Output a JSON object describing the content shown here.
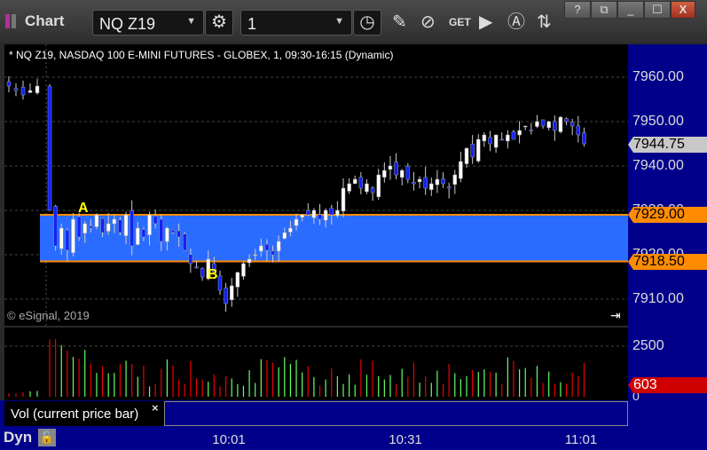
{
  "window": {
    "title": "Chart",
    "help": "?",
    "minimize": "_",
    "maximize": "☐",
    "close": "X"
  },
  "toolbar": {
    "symbol": "NQ Z19",
    "interval": "1"
  },
  "chart": {
    "header": "* NQ Z19, NASDAQ 100 E-MINI FUTURES - GLOBEX, 1, 09:30-16:15 (Dynamic)",
    "copyright": "© eSignal, 2019",
    "price_ticks": [
      "7960.00",
      "7950.00",
      "7940.00",
      "7930.00",
      "7920.00",
      "7910.00"
    ],
    "last_price": "7944.75",
    "level_high": "7929.00",
    "level_low": "7918.50",
    "label_a": "A",
    "label_b": "B",
    "zone_color": "#2a6cff",
    "level_color": "#ff8c00",
    "vol_ticks": [
      "2500",
      "0"
    ],
    "vol_last": "603",
    "vol_legend": "Vol (current price bar)",
    "vol_close": "×",
    "time_ticks": [
      "10:01",
      "10:31",
      "11:01"
    ],
    "mode": "Dyn",
    "price_series": [
      7958,
      7957,
      7956,
      7957,
      7958,
      7930,
      7922,
      7926,
      7921,
      7928,
      7924,
      7927,
      7926,
      7929,
      7925,
      7927,
      7928,
      7925,
      7929,
      7922,
      7926,
      7924,
      7929,
      7927,
      7923,
      7926,
      7925,
      7924,
      7921,
      7918,
      7917,
      7915,
      7919,
      7916,
      7912,
      7909,
      7913,
      7916,
      7918,
      7919,
      7920,
      7922,
      7921,
      7920,
      7923,
      7925,
      7926,
      7928,
      7929,
      7929,
      7930,
      7928,
      7930,
      7929,
      7930,
      7935,
      7936,
      7937,
      7935,
      7936,
      7934,
      7938,
      7939,
      7940,
      7938,
      7939,
      7937,
      7936,
      7937,
      7935,
      7936,
      7937,
      7936,
      7935,
      7938,
      7941,
      7944,
      7942,
      7946,
      7947,
      7945,
      7947,
      7946,
      7947,
      7946,
      7948,
      7949,
      7948,
      7950,
      7949,
      7950,
      7948,
      7951,
      7950,
      7949,
      7947,
      7945
    ]
  }
}
